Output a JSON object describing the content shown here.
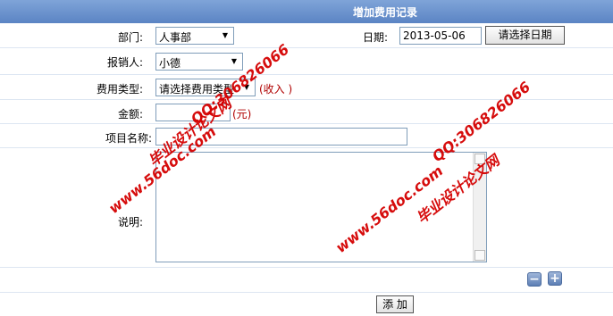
{
  "title": "增加费用记录",
  "department": {
    "label": "部门:",
    "value": "人事部"
  },
  "date": {
    "label": "日期:",
    "value": "2013-05-06",
    "button": "请选择日期"
  },
  "reporter": {
    "label": "报销人:",
    "value": "小德"
  },
  "expense_type": {
    "label": "费用类型:",
    "value": "请选择费用类型",
    "hint": "(收入 )"
  },
  "amount": {
    "label": "金额:",
    "value": "",
    "unit": "(元)"
  },
  "project": {
    "label": "项目名称:",
    "value": ""
  },
  "description": {
    "label": "说明:",
    "value": ""
  },
  "controls": {
    "minus_icon": "minus-icon",
    "plus_icon": "plus-icon"
  },
  "submit": {
    "label": "添 加"
  },
  "watermark": {
    "site": "www.56doc.com",
    "name": "毕业设计论文网",
    "qq": "QQ:306826066"
  }
}
